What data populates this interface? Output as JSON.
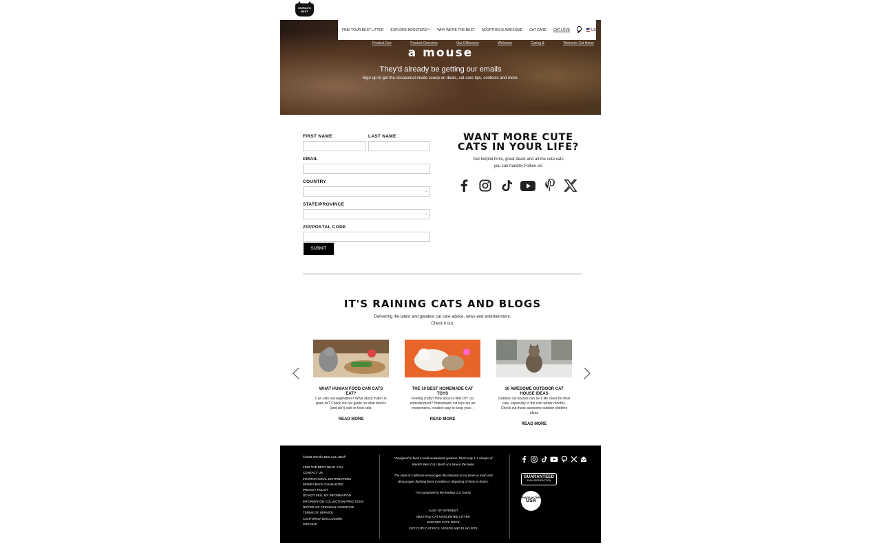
{
  "logo": {
    "text": "WORLD'S BEST"
  },
  "nav": {
    "items": [
      "FIND YOUR BEST LITTER",
      "EXPLORE BOOSTERS™",
      "WHY WE'RE THE BEST",
      "ADOPTION IS AWESOME",
      "CAT CARE",
      "CAT LOVE"
    ],
    "country": "US"
  },
  "subnav": {
    "items": [
      "Product Ove",
      "Product Overview",
      "Our Difference",
      "Welcome",
      "Caring &",
      "Welcome Cat Home"
    ]
  },
  "hero": {
    "title": "a mouse",
    "subtitle": "They'd already be getting our emails",
    "small": "Sign up to get the occasional inside scoop on deals, cat care tips, contests and more."
  },
  "form": {
    "first_name_label": "FIRST NAME",
    "last_name_label": "LAST NAME",
    "email_label": "EMAIL",
    "country_label": "COUNTRY",
    "state_label": "STATE/PROVINCE",
    "zip_label": "ZIP/POSTAL CODE",
    "submit_label": "SUBMIT"
  },
  "social": {
    "title": "WANT MORE CUTE CATS IN YOUR LIFE?",
    "text": "Get helpful hints, great deals and all the cute cats you can handle! Follow us!"
  },
  "blogs": {
    "title": "IT'S RAINING CATS AND BLOGS",
    "subtitle": "Delivering the latest and greatest cat care advice, news and entertainment. Check it out.",
    "cards": [
      {
        "title": "WHAT HUMAN FOOD CAN CATS EAT?",
        "text": "Can cats eat vegetables? What about fruits? Is grain ok? Check out our guide on what food is (and isn't) safe to feed cats.",
        "link": "READ MORE"
      },
      {
        "title": "THE 10 BEST HOMEMADE CAT TOYS",
        "text": "Feeling crafty? How about a little DIY cat entertainment? Homemade cat toys are an inexpensive, creative way to keep your...",
        "link": "READ MORE"
      },
      {
        "title": "10 AWESOME OUTDOOR CAT HOUSE IDEAS",
        "text": "Outdoor cat houses can be a life saver for feral cats, especially in the cold winter months. Check out these awesome outdoor shelters ideas",
        "link": "READ MORE"
      }
    ]
  },
  "footer": {
    "copyright": "©2025 World's Best Cat Litter®",
    "links": [
      "FIND THE BEST NEAR YOU",
      "CONTACT US",
      "INTERNATIONAL DISTRIBUTORS",
      "MONEY-BACK GUARANTEE",
      "PRIVACY POLICY",
      "DO NOT SELL MY INFORMATION",
      "INFORMATION COLLECTION PRACTICES",
      "NOTICE OF FINANCIAL INCENTIVE",
      "TERMS OF SERVICE",
      "CALIFORNIA DISCLOSURE",
      "SITE MAP"
    ],
    "notes": [
      "*Designed to flush in well-maintained systems. Flush only 1-2 clumps of World's Best Cat Litter® at a time in the toilet.",
      "The state of California encourages the disposal of cat feces in trash and discourages flushing feces in toilets or disposing of them in drains.",
      "†As compared to the leading U.S. brand."
    ],
    "also_links": [
      "ALSO OF INTEREST",
      "MULTIPLE CAT UNSCENTED LITTER",
      "SHELTER CATS ROCK",
      "GET CUTE CAT PICS, VIDEOS AND PLAYLISTS"
    ],
    "badge_guaranteed": "GUARANTEED",
    "badge_guaranteed_small": "100% SATISFACTION",
    "badge_usa_top": "MADE IN THE",
    "badge_usa": "USA"
  },
  "colors": {
    "footer_bg": "#000000",
    "submit_bg": "#000000",
    "accent_flag_red": "#bb2222",
    "accent_flag_blue": "#223399"
  }
}
